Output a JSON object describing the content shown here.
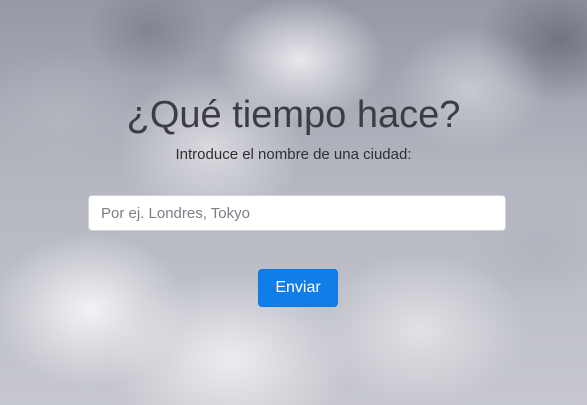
{
  "page": {
    "title": "¿Qué tiempo hace?",
    "subtitle": "Introduce el nombre de una ciudad:"
  },
  "search": {
    "value": "",
    "placeholder": "Por ej. Londres, Tokyo"
  },
  "actions": {
    "submit_label": "Enviar"
  },
  "colors": {
    "accent": "#117de7",
    "title_text": "#3c3d42",
    "background_clouds": "#b4b6c0"
  },
  "background": {
    "image": "cloudy-sky"
  }
}
